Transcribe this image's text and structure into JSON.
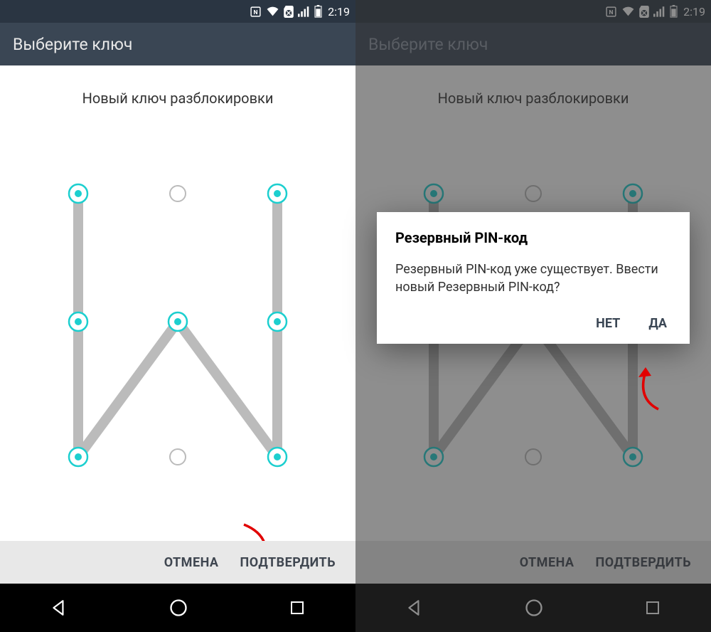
{
  "statusbar": {
    "time": "2:19"
  },
  "header": {
    "title": "Выберите ключ"
  },
  "content": {
    "subtitle": "Новый ключ разблокировки"
  },
  "buttons": {
    "cancel": "ОТМЕНА",
    "confirm": "ПОДТВЕРДИТЬ"
  },
  "dialog": {
    "title": "Резервный PIN-код",
    "body": "Резервный PIN-код уже существует. Ввести новый Резервный PIN-код?",
    "no": "НЕТ",
    "yes": "ДА"
  },
  "pattern": {
    "selected_dots": [
      0,
      3,
      6,
      4,
      8,
      5,
      2
    ],
    "unselected_dots": [
      1,
      7
    ]
  }
}
